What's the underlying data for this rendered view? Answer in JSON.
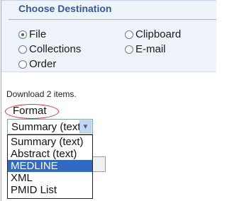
{
  "destination": {
    "title": "Choose Destination",
    "options": [
      {
        "label": "File",
        "selected": true
      },
      {
        "label": "Clipboard",
        "selected": false
      },
      {
        "label": "Collections",
        "selected": false
      },
      {
        "label": "E-mail",
        "selected": false
      },
      {
        "label": "Order",
        "selected": false
      }
    ]
  },
  "download": {
    "info": "Download 2 items.",
    "format_label": "Format",
    "format_value": "Summary (text)",
    "format_options": [
      "Summary (text)",
      "Abstract (text)",
      "MEDLINE",
      "XML",
      "PMID List"
    ],
    "highlighted_option": "MEDLINE"
  },
  "colors": {
    "title": "#305b9c",
    "panel_background": "#eef3fa",
    "highlight": "#316ac5",
    "annotation_ellipse": "#d82a2a"
  }
}
